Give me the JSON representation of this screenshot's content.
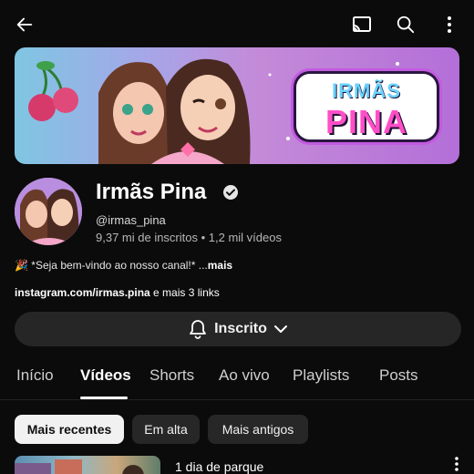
{
  "topbar": {
    "icons": [
      "back-arrow-icon",
      "cast-icon",
      "search-icon",
      "more-vert-icon"
    ]
  },
  "banner": {
    "wordmark_line1": "IRMÃS",
    "wordmark_line2": "PINA"
  },
  "channel": {
    "name": "Irmãs Pina",
    "handle": "@irmas_pina",
    "stats": "9,37 mi de inscritos • 1,2 mil vídeos",
    "description_emoji": "🎉",
    "description": "*Seja bem-vindo ao nosso canal!* ...",
    "description_more": "mais",
    "link_main": "instagram.com/irmas.pina",
    "link_extra": " e mais 3 links"
  },
  "subscribe": {
    "label": "Inscrito"
  },
  "tabs": [
    {
      "label": "Início"
    },
    {
      "label": "Vídeos"
    },
    {
      "label": "Shorts"
    },
    {
      "label": "Ao vivo"
    },
    {
      "label": "Playlists"
    },
    {
      "label": "Posts"
    }
  ],
  "active_tab": "Vídeos",
  "chips": [
    {
      "label": "Mais recentes"
    },
    {
      "label": "Em alta"
    },
    {
      "label": "Mais antigos"
    }
  ],
  "selected_chip": "Mais recentes",
  "video": {
    "title": "1 dia de parque"
  },
  "colors": {
    "background": "#0b0b0b",
    "button_bg": "#262626",
    "chip_active_bg": "#f1f1f1",
    "wordmark_pink": "#ff4fc8",
    "wordmark_blue": "#6bd2ff"
  }
}
